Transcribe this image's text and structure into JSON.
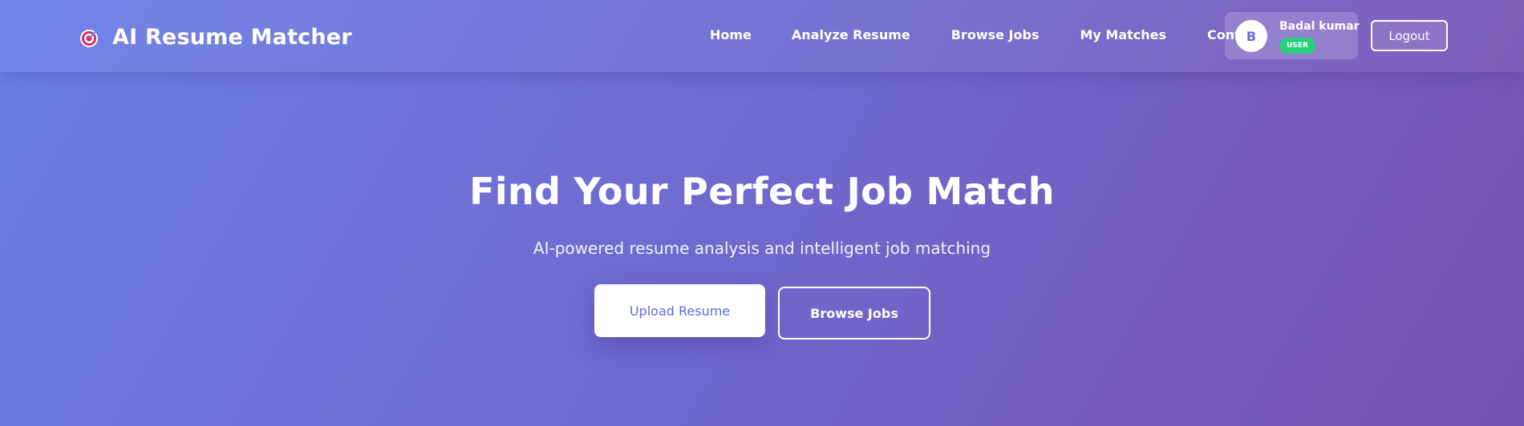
{
  "header": {
    "brand_icon": "target-dart-icon",
    "brand_title": "AI Resume Matcher",
    "nav": [
      {
        "label": "Home"
      },
      {
        "label": "Analyze Resume"
      },
      {
        "label": "Browse Jobs"
      },
      {
        "label": "My Matches"
      },
      {
        "label": "Contact"
      }
    ],
    "user": {
      "avatar_initial": "B",
      "name": "Badal kumar",
      "role": "USER",
      "role_color": "#27d07a"
    },
    "logout_label": "Logout"
  },
  "hero": {
    "title": "Find Your Perfect Job Match",
    "subtitle": "AI-powered resume analysis and intelligent job matching",
    "primary_button": "Upload Resume",
    "secondary_button": "Browse Jobs"
  },
  "colors": {
    "gradient_start": "#6a7ee6",
    "gradient_end": "#7650b0",
    "accent": "#5d6bd8"
  }
}
